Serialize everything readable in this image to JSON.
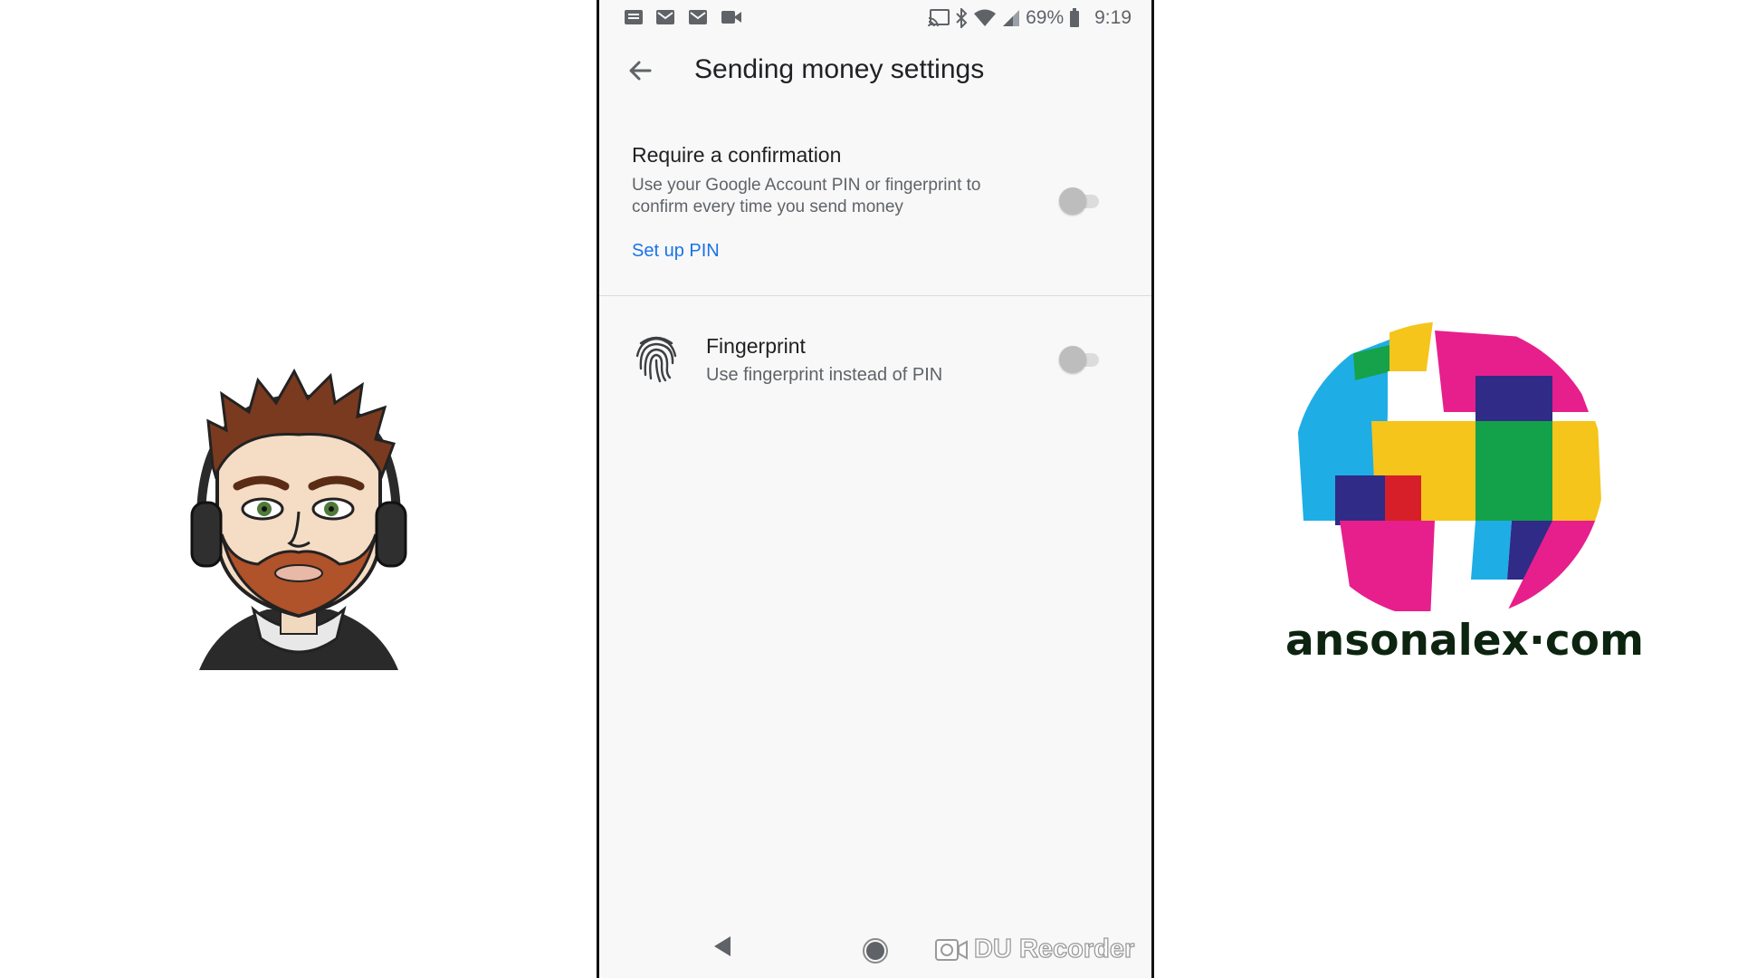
{
  "status_bar": {
    "notification_icons": [
      "messages-icon",
      "gmail-icon",
      "gmail-icon",
      "video-camera-icon"
    ],
    "system_icons": [
      "cast-icon",
      "bluetooth-icon",
      "wifi-icon",
      "cell-signal-icon",
      "battery-icon"
    ],
    "battery_percent": "69%",
    "time": "9:19"
  },
  "app_bar": {
    "back_icon": "arrow-back-icon",
    "title": "Sending money settings"
  },
  "confirmation": {
    "title": "Require a confirmation",
    "description": "Use your Google Account PIN or fingerprint to confirm every time you send money",
    "link": "Set up PIN",
    "enabled": false
  },
  "fingerprint": {
    "icon": "fingerprint-icon",
    "title": "Fingerprint",
    "description": "Use fingerprint instead of PIN",
    "enabled": false
  },
  "nav_bar": {
    "icons": [
      "nav-back-icon",
      "nav-home-icon"
    ]
  },
  "watermark": {
    "text": "DU Recorder"
  },
  "branding": {
    "logo_text": "ansonalex·com"
  },
  "colors": {
    "link": "#1a73e8",
    "toggle_off_thumb": "#bdbdbd",
    "toggle_off_track": "#dcdcdc"
  }
}
